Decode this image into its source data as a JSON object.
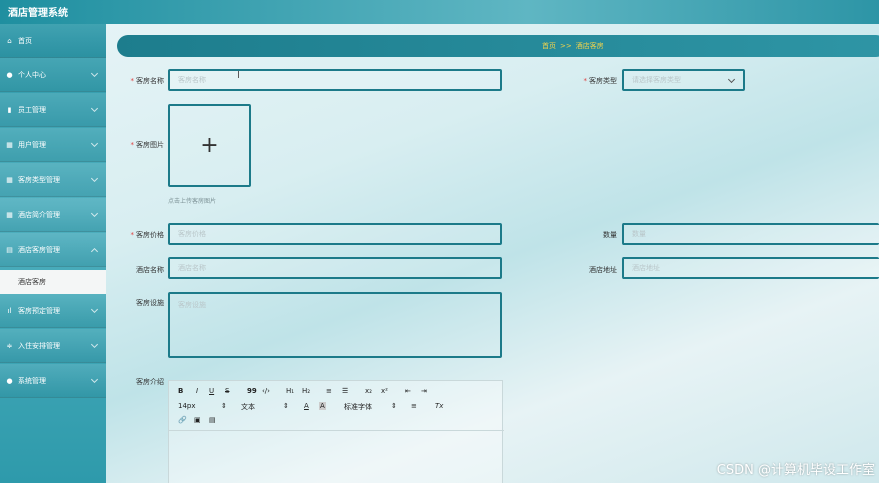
{
  "app": {
    "title": "酒店管理系统"
  },
  "sidebar": {
    "items": [
      {
        "label": "首页",
        "icon": "home-icon",
        "glyph": "⌂"
      },
      {
        "label": "个人中心",
        "icon": "user-icon",
        "glyph": "●"
      },
      {
        "label": "员工管理",
        "icon": "chart-icon",
        "glyph": "▮"
      },
      {
        "label": "用户管理",
        "icon": "grid-icon",
        "glyph": "▦"
      },
      {
        "label": "客房类型管理",
        "icon": "grid-icon",
        "glyph": "▦"
      },
      {
        "label": "酒店简介管理",
        "icon": "grid-icon",
        "glyph": "▦"
      },
      {
        "label": "酒店客房管理",
        "icon": "list-icon",
        "glyph": "▤"
      },
      {
        "label": "客房预定管理",
        "icon": "bar-chart-icon",
        "glyph": "ıl"
      },
      {
        "label": "入住安排管理",
        "icon": "sliders-icon",
        "glyph": "≑"
      },
      {
        "label": "系统管理",
        "icon": "user-icon",
        "glyph": "●"
      }
    ],
    "active_sub": "酒店客房"
  },
  "breadcrumb": {
    "home": "首页",
    "sep": ">>",
    "current": "酒店客房"
  },
  "form": {
    "room_name": {
      "label": "客房名称",
      "placeholder": "客房名称"
    },
    "room_type": {
      "label": "客房类型",
      "placeholder": "请选择客房类型"
    },
    "room_image": {
      "label": "客房图片",
      "plus": "+",
      "hint": "点击上传客房图片"
    },
    "room_price": {
      "label": "客房价格",
      "placeholder": "客房价格"
    },
    "quantity": {
      "label": "数量",
      "placeholder": "数量"
    },
    "hotel_name": {
      "label": "酒店名称",
      "placeholder": "酒店名称"
    },
    "hotel_address": {
      "label": "酒店地址",
      "placeholder": "酒店地址"
    },
    "facilities": {
      "label": "客房设施",
      "placeholder": "客房设施"
    },
    "intro": {
      "label": "客房介绍"
    }
  },
  "editor": {
    "bold": "B",
    "italic": "I",
    "underline": "U",
    "strike": "S",
    "quote": "99",
    "code": "‹/›",
    "h1": "H₁",
    "h2": "H₂",
    "ol": "≡",
    "ul": "☰",
    "sub": "x₂",
    "sup": "x²",
    "outdent": "⇤",
    "indent": "⇥",
    "font_size": "14px",
    "text_style": "文本",
    "font_family": "标准字体",
    "font_color": "A",
    "bg_color": "A",
    "align": "≡",
    "clear": "Tx"
  },
  "watermark": "CSDN @计算机毕设工作室"
}
